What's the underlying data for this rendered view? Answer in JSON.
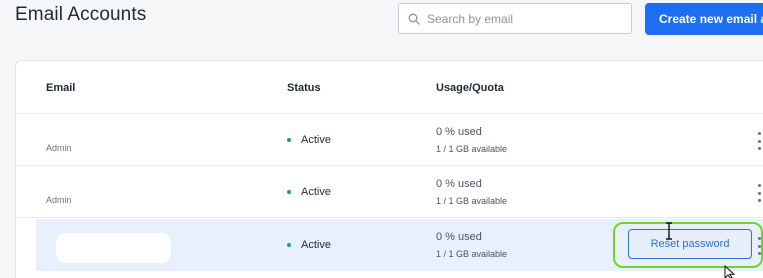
{
  "page": {
    "title": "Email Accounts"
  },
  "search": {
    "placeholder": "Search by email",
    "icon": "search-icon"
  },
  "create_button": {
    "label": "Create new email acco"
  },
  "table": {
    "columns": [
      "Email",
      "Status",
      "Usage/Quota"
    ],
    "rows": [
      {
        "email_label": "Admin",
        "status": "Active",
        "usage": "0 % used",
        "quota": "1 / 1 GB available"
      },
      {
        "email_label": "Admin",
        "status": "Active",
        "usage": "0 % used",
        "quota": "1 / 1 GB available"
      },
      {
        "email_label": "",
        "status": "Active",
        "usage": "0 % used",
        "quota": "1 / 1 GB available"
      }
    ]
  },
  "row_action": {
    "reset_label": "Reset password"
  },
  "colors": {
    "primary": "#1d6ef2",
    "status_active": "#22a55a",
    "selected_row": "#e8effd",
    "highlight": "#6ed52a"
  }
}
